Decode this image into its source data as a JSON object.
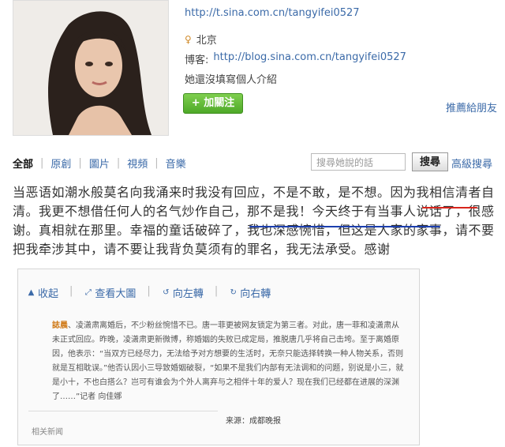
{
  "profile": {
    "weibo_url": "http://t.sina.com.cn/tangyifei0527",
    "location": "北京",
    "blog_label": "博客:",
    "blog_url": "http://blog.sina.com.cn/tangyifei0527",
    "intro": "她還沒填寫個人介紹",
    "follow_label": "加關注",
    "recommend_label": "推薦給朋友"
  },
  "tabs": [
    "全部",
    "原創",
    "圖片",
    "視頻",
    "音樂"
  ],
  "search": {
    "placeholder": "搜尋她說的話",
    "button_label": "搜尋",
    "advanced_label": "高級搜尋"
  },
  "post": {
    "text": "当恶语如潮水般莫名向我涌来时我没有回应，不是不敢，是不想。因为我相信清者自清。我更不想借任何人的名气炒作自己，那不是我！今天终于有当事人说话了，很感谢。真相就在那里。幸福的童话破碎了，我也深感惋惜，但这是人家的家事，请不要把我牵涉其中，请不要让我背负莫须有的罪名，我无法承受。感谢"
  },
  "card": {
    "tools": [
      {
        "icon": "collapse-icon",
        "label": "收起"
      },
      {
        "icon": "zoom-icon",
        "label": "查看大圖"
      },
      {
        "icon": "rotate-left-icon",
        "label": "向左轉"
      },
      {
        "icon": "rotate-right-icon",
        "label": "向右轉"
      }
    ],
    "news_highlight": "誌晨",
    "news_text": "、凌潇肃离婚后，不少粉丝惋惜不已。唐一菲更被网友锁定为第三者。对此，唐一菲和凌潇肃从未正式回应。昨晚，凌潇肃更新微博，称婚姻的失败已成定局，推脱唐几乎将自己击垮。至于离婚原因，他表示：“当双方已经尽力，无法给予对方想要的生活时，无奈只能选择转换一种人物关系，否则就是互相耽误。”他否认因小三导致婚姻破裂，“如果不是我们内部有无法调和的问题，别说是小三，就是小十，不也白搭么？岂可有谁会为个外人离弃与之相伴十年的爱人？现在我们已经都在进展的深渊了……”记者 向佳娜",
    "source": "来源：成都晚报",
    "bottom_cut": "相关新闻"
  }
}
